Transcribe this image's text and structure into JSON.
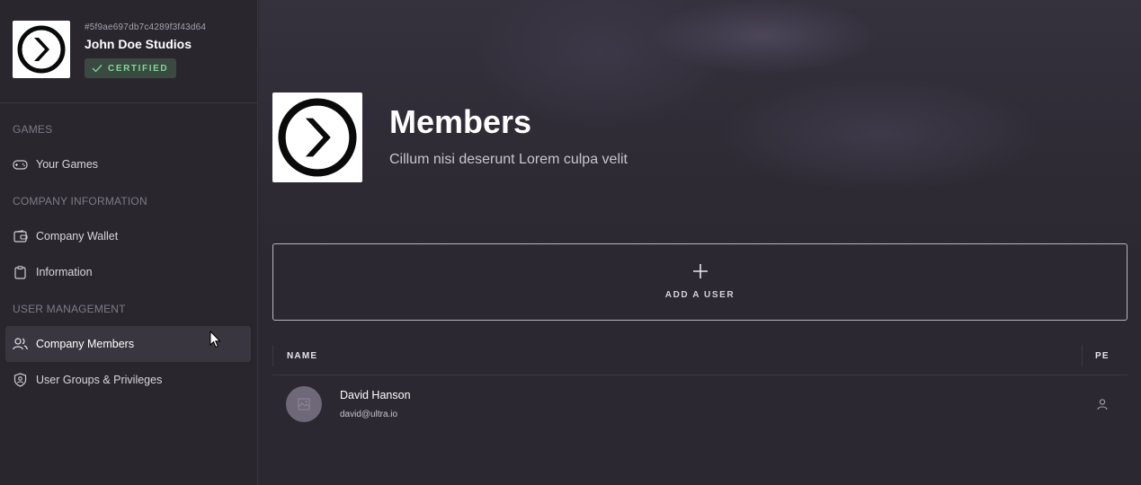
{
  "company": {
    "id": "#5f9ae697db7c4289f3f43d64",
    "name": "John Doe Studios",
    "badge": "CERTIFIED",
    "logo_icon": "chevron-circle-logo"
  },
  "sidebar": {
    "sections": [
      {
        "title": "GAMES",
        "items": [
          {
            "label": "Your Games",
            "icon": "gamepad-icon"
          }
        ]
      },
      {
        "title": "COMPANY INFORMATION",
        "items": [
          {
            "label": "Company Wallet",
            "icon": "wallet-icon"
          },
          {
            "label": "Information",
            "icon": "clipboard-icon"
          }
        ]
      },
      {
        "title": "USER MANAGEMENT",
        "items": [
          {
            "label": "Company Members",
            "icon": "users-icon",
            "active": true
          },
          {
            "label": "User Groups & Privileges",
            "icon": "shield-user-icon"
          }
        ]
      }
    ]
  },
  "page": {
    "title": "Members",
    "subtitle": "Cillum nisi deserunt Lorem culpa velit"
  },
  "add_user": {
    "icon": "plus-icon",
    "label": "ADD A USER"
  },
  "table": {
    "columns": [
      "NAME",
      "PE"
    ],
    "rows": [
      {
        "name": "David Hanson",
        "email": "david@ultra.io",
        "avatar_icon": "image-placeholder-icon",
        "status_icon": "user-icon"
      }
    ]
  },
  "colors": {
    "background": "#2b2831",
    "sidebar": "#29262e",
    "badge_bg": "#3a4a40",
    "badge_text": "#7fd79a",
    "active_item": "#39363f"
  }
}
